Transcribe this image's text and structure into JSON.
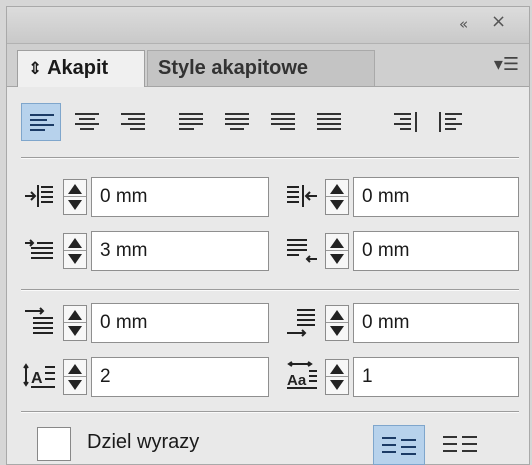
{
  "window": {
    "collapse_glyph": "«",
    "close_glyph": "×"
  },
  "tabs": [
    {
      "label": "Akapit",
      "glyph": "⇕",
      "active": true
    },
    {
      "label": "Style akapitowe",
      "active": false
    }
  ],
  "panel_menu_icon": "panel-menu-icon",
  "alignment_buttons": [
    {
      "name": "align-left",
      "active": true
    },
    {
      "name": "align-center",
      "active": false
    },
    {
      "name": "align-right",
      "active": false
    },
    {
      "name": "justify-left",
      "active": false
    },
    {
      "name": "justify-center",
      "active": false
    },
    {
      "name": "justify-right",
      "active": false
    },
    {
      "name": "justify-all",
      "active": false
    },
    {
      "name": "align-toward-spine",
      "active": false
    },
    {
      "name": "align-away-from-spine",
      "active": false
    }
  ],
  "fields": {
    "left_indent": "0 mm",
    "right_indent": "0 mm",
    "first_line_indent": "3 mm",
    "last_line_right_indent": "0 mm",
    "space_before": "0 mm",
    "space_after": "0 mm",
    "drop_cap_lines": "2",
    "drop_cap_characters": "1"
  },
  "hyphenate": {
    "label": "Dziel wyrazy",
    "checked": false
  },
  "bottom_buttons": [
    {
      "name": "do-not-align-to-baseline-grid",
      "active": true
    },
    {
      "name": "align-to-baseline-grid",
      "active": false
    }
  ],
  "colors": {
    "selected": "#b7d2ec",
    "panel": "#e9e9e9"
  }
}
